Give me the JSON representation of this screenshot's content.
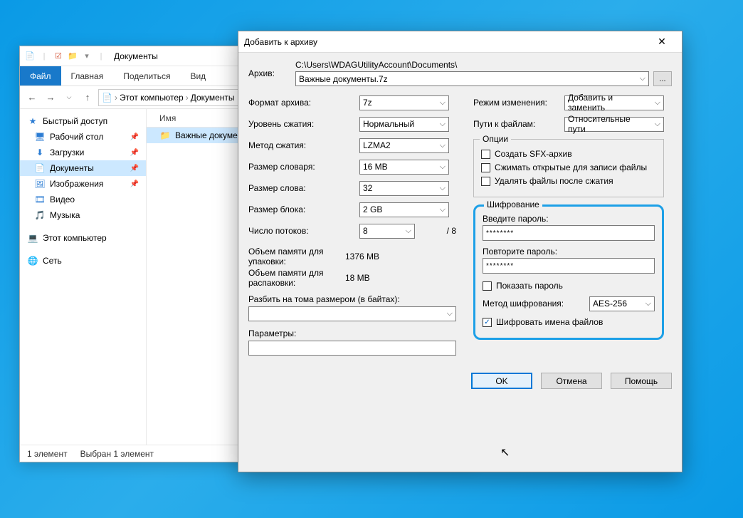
{
  "explorer": {
    "title": "Документы",
    "tabs": {
      "file": "Файл",
      "home": "Главная",
      "share": "Поделиться",
      "view": "Вид"
    },
    "breadcrumb": {
      "root": "Этот компьютер",
      "folder": "Документы"
    },
    "sidebar": {
      "quick_access": "Быстрый доступ",
      "desktop": "Рабочий стол",
      "downloads": "Загрузки",
      "documents": "Документы",
      "pictures": "Изображения",
      "videos": "Видео",
      "music": "Музыка",
      "this_pc": "Этот компьютер",
      "network": "Сеть"
    },
    "list": {
      "header_name": "Имя",
      "folder": "Важные документы"
    },
    "status": {
      "count": "1 элемент",
      "selection": "Выбран 1 элемент"
    }
  },
  "dlg": {
    "title": "Добавить к архиву",
    "archive_label": "Архив:",
    "archive_path": "C:\\Users\\WDAGUtilityAccount\\Documents\\",
    "archive_name": "Важные документы.7z",
    "browse": "...",
    "format_label": "Формат архива:",
    "format": "7z",
    "level_label": "Уровень сжатия:",
    "level": "Нормальный",
    "method_label": "Метод сжатия:",
    "method": "LZMA2",
    "dict_label": "Размер словаря:",
    "dict": "16 MB",
    "word_label": "Размер слова:",
    "word": "32",
    "block_label": "Размер блока:",
    "block": "2 GB",
    "threads_label": "Число потоков:",
    "threads": "8",
    "threads_max": "/ 8",
    "mem_pack_label": "Объем памяти для упаковки:",
    "mem_pack": "1376 MB",
    "mem_unpack_label": "Объем памяти для распаковки:",
    "mem_unpack": "18 MB",
    "split_label": "Разбить на тома размером (в байтах):",
    "params_label": "Параметры:",
    "update_mode_label": "Режим изменения:",
    "update_mode": "Добавить и заменить",
    "path_mode_label": "Пути к файлам:",
    "path_mode": "Относительные пути",
    "options_legend": "Опции",
    "opt_sfx": "Создать SFX-архив",
    "opt_shared": "Сжимать открытые для записи файлы",
    "opt_delete": "Удалять файлы после сжатия",
    "encrypt_legend": "Шифрование",
    "pw1_label": "Введите пароль:",
    "pw2_label": "Повторите пароль:",
    "pw_mask": "********",
    "show_pw": "Показать пароль",
    "enc_method_label": "Метод шифрования:",
    "enc_method": "AES-256",
    "enc_names": "Шифровать имена файлов",
    "ok": "OK",
    "cancel": "Отмена",
    "help": "Помощь"
  }
}
